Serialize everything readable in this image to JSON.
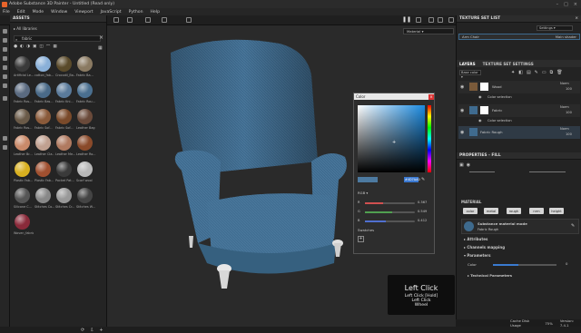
{
  "title": "Adobe Substance 3D Painter - Untitled (Read only)",
  "menu": [
    "File",
    "Edit",
    "Mode",
    "Window",
    "Viewport",
    "JavaScript",
    "Python",
    "Help"
  ],
  "assets": {
    "title": "ASSETS",
    "library": "All libraries",
    "search": "fabric",
    "items": [
      {
        "label": "Artificial Le...",
        "color": "#3a3a3a"
      },
      {
        "label": "cotton_fab...",
        "color": "#8ab0d8"
      },
      {
        "label": "Crocodil_Ba...",
        "color": "#5a4a2a"
      },
      {
        "label": "Fabric Ba...",
        "color": "#8a7a62"
      },
      {
        "label": "Fabric Ros...",
        "color": "#5a6a80"
      },
      {
        "label": "Fabric Bas...",
        "color": "#4a6a88"
      },
      {
        "label": "Fabric Kni...",
        "color": "#5a7a9a"
      },
      {
        "label": "Fabric Rou...",
        "color": "#4a6f8f"
      },
      {
        "label": "Fabric Ros...",
        "color": "#6a5a48"
      },
      {
        "label": "Fabric Sof...",
        "color": "#8a5a3a"
      },
      {
        "label": "Fabric Sof...",
        "color": "#7a4a2a"
      },
      {
        "label": "Leather Bag",
        "color": "#6a4a3a"
      },
      {
        "label": "Leather Br...",
        "color": "#c98a6a"
      },
      {
        "label": "Leather Cla...",
        "color": "#c0a090"
      },
      {
        "label": "Leather Me...",
        "color": "#b07a60"
      },
      {
        "label": "Leather Ro...",
        "color": "#8a4a2a"
      },
      {
        "label": "Plastic Fab...",
        "color": "#d8b020"
      },
      {
        "label": "Plastic Fab...",
        "color": "#a05030"
      },
      {
        "label": "Pocket Pat...",
        "color": "#3a3a3a"
      },
      {
        "label": "Scarf wool",
        "color": "#b8b8b8"
      },
      {
        "label": "Silicone C...",
        "color": "#555"
      },
      {
        "label": "Stitches Co...",
        "color": "#888"
      },
      {
        "label": "Stitches Cr...",
        "color": "#999"
      },
      {
        "label": "Stitches W...",
        "color": "#444"
      },
      {
        "label": "Woven_fabric",
        "color": "#8a2a3a"
      }
    ]
  },
  "viewport": {
    "mode": "Material"
  },
  "texture_set_list": {
    "title": "TEXTURE SET LIST",
    "settings": "Settings",
    "item": "Arm Chair",
    "shader": "Main shader"
  },
  "layers": {
    "tab1": "LAYERS",
    "tab2": "TEXTURE SET SETTINGS",
    "channel": "Base color",
    "items": [
      {
        "name": "Wood",
        "blend": "Norm",
        "opacity": "100",
        "child": "Color selection"
      },
      {
        "name": "Fabric",
        "blend": "Norm",
        "opacity": "100",
        "child": "Color selection"
      },
      {
        "name": "Fabric Rough",
        "blend": "Norm",
        "opacity": "100",
        "child": ""
      }
    ]
  },
  "properties": {
    "title": "PROPERTIES - FILL",
    "material": "MATERIAL",
    "chips": [
      "color",
      "metal",
      "rough",
      "nrm",
      "height"
    ],
    "mode_title": "Substance material mode",
    "mode_value": "Fabric Rough",
    "sections": [
      "Attributes",
      "Channels mapping",
      "Parameters"
    ],
    "param_label": "Color",
    "param_value": "0",
    "technical": "Technical Parameters"
  },
  "color_dialog": {
    "title": "Color",
    "hex": "#4D7AA0",
    "mode": "RGB",
    "rows": [
      {
        "label": "R",
        "value": "0.367",
        "pct": 0.37,
        "color": "#d05050"
      },
      {
        "label": "G",
        "value": "0.549",
        "pct": 0.55,
        "color": "#50a050"
      },
      {
        "label": "B",
        "value": "0.412",
        "pct": 0.41,
        "color": "#5070d0"
      }
    ],
    "swatches": "Swatches",
    "add": "+"
  },
  "overlay": {
    "title": "Left Click",
    "lines": [
      "Left Click [Hold]",
      "Left Click",
      "Wheel"
    ]
  },
  "status": {
    "cache": "Cache Disk Usage",
    "percent": "75%",
    "version": "Version: 7.4.1"
  }
}
